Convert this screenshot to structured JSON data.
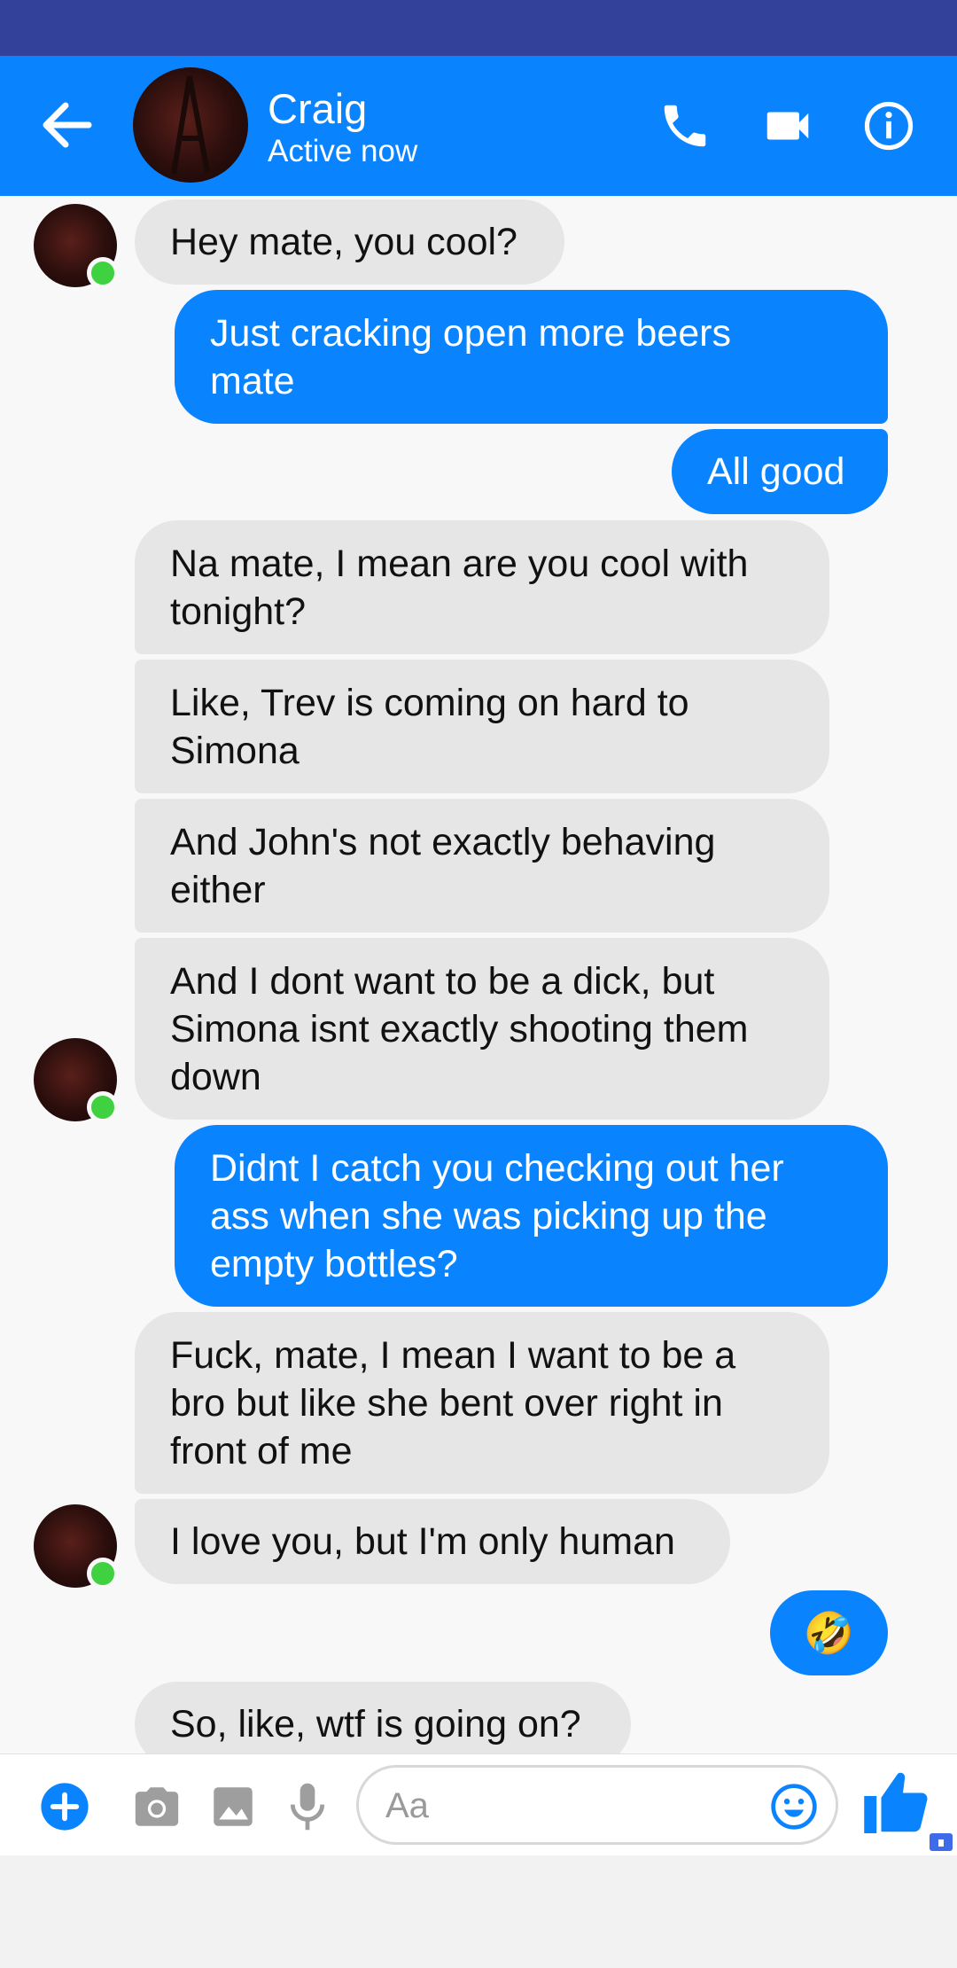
{
  "header": {
    "contact_name": "Craig",
    "contact_status": "Active now",
    "icons": [
      "back-arrow-icon",
      "phone-icon",
      "video-camera-icon",
      "info-icon"
    ]
  },
  "messages": [
    {
      "from": "contact",
      "text": "Hey mate, you cool?"
    },
    {
      "from": "me",
      "text": "Just cracking open more beers\nmate"
    },
    {
      "from": "me",
      "text": "All good"
    },
    {
      "from": "contact",
      "text": "Na mate, I mean are you cool with\ntonight?"
    },
    {
      "from": "contact",
      "text": "Like, Trev is coming on hard to\nSimona"
    },
    {
      "from": "contact",
      "text": "And John's not exactly behaving\neither"
    },
    {
      "from": "contact",
      "text": "And I dont want to be a dick, but\nSimona isnt exactly shooting them\ndown"
    },
    {
      "from": "me",
      "text": "Didnt I catch you checking out her\nass when she was picking up the\nempty bottles?"
    },
    {
      "from": "contact",
      "text": "Fuck, mate, I mean I want to be a\nbro but like she bent over right in\nfront of me"
    },
    {
      "from": "contact",
      "text": "I love you, but I'm only human"
    },
    {
      "from": "me",
      "text": "🤣"
    },
    {
      "from": "contact",
      "text": "So, like, wtf is going on?"
    }
  ],
  "composer": {
    "placeholder": "Aa",
    "icons": [
      "plus-icon",
      "camera-icon",
      "image-icon",
      "microphone-icon",
      "emoji-icon",
      "thumbs-up-icon"
    ]
  },
  "colors": {
    "status_bar": "#33419a",
    "header": "#0a83ff",
    "outgoing_bubble": "#0a83ff",
    "incoming_bubble": "#e6e6e6",
    "online_dot": "#3fd13f"
  }
}
